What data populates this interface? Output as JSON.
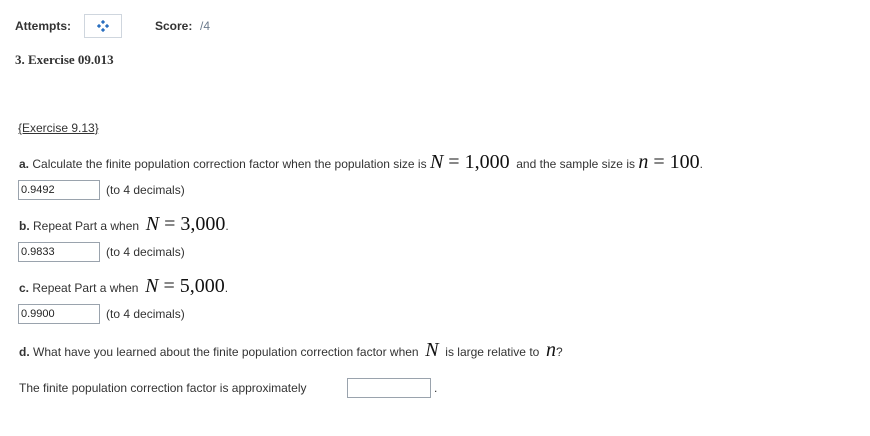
{
  "header": {
    "attempts_label": "Attempts:",
    "score_label": "Score:",
    "score_value": "/4"
  },
  "exercise": {
    "title": "3. Exercise 09.013",
    "link_text": "{Exercise 9.13}"
  },
  "parts": {
    "a": {
      "letter": "a.",
      "text_before": "Calculate the finite population correction factor when the population size is",
      "math1_var": "N",
      "math1_rest": " = 1,000",
      "text_middle": "and the sample size is",
      "math2_var": "n",
      "math2_rest": " = 100",
      "trailing": ".",
      "answer": "0.9492",
      "hint": "(to 4 decimals)"
    },
    "b": {
      "letter": "b.",
      "text_before": "Repeat Part a when",
      "math_var": "N",
      "math_rest": " = 3,000",
      "trailing": ".",
      "answer": "0.9833",
      "hint": "(to 4 decimals)"
    },
    "c": {
      "letter": "c.",
      "text_before": "Repeat Part a when",
      "math_var": "N",
      "math_rest": " = 5,000",
      "trailing": ".",
      "answer": "0.9900",
      "hint": "(to 4 decimals)"
    },
    "d": {
      "letter": "d.",
      "text_before": "What have you learned about the finite population correction factor when",
      "math1_var": "N",
      "text_middle": "is large relative to",
      "math2_var": "n",
      "trailing": "?",
      "sentence": "The finite population correction factor is approximately",
      "answer": "",
      "period": "."
    }
  },
  "colors": {
    "input_border": "#9aa3ad",
    "attempt_icon": "#2a6fbf",
    "score_value": "#6b7a8c"
  },
  "icons": {
    "attempts": "attempts-diamond-icon"
  }
}
